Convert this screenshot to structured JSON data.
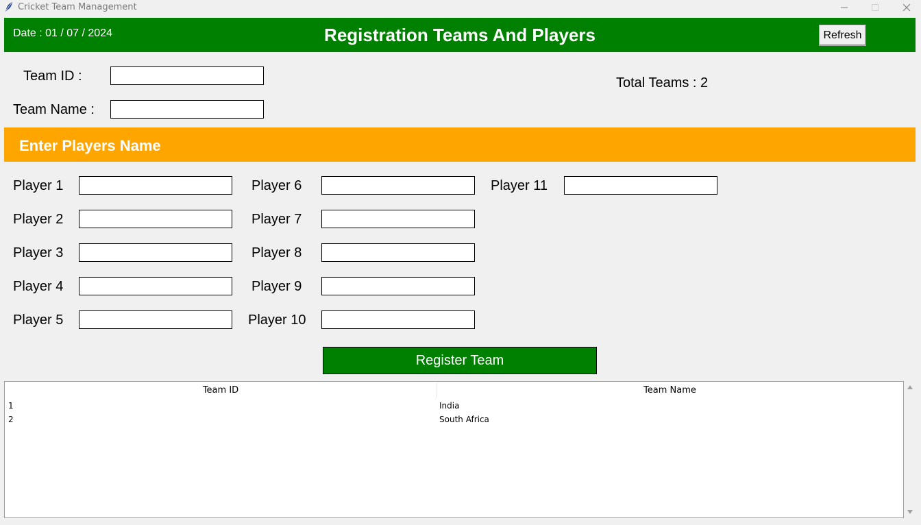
{
  "window": {
    "title": "Cricket Team Management",
    "icons": [
      "feather-icon",
      "minimize-icon",
      "maximize-icon",
      "close-icon"
    ]
  },
  "header": {
    "date": "Date : 01 / 07 / 2024",
    "title": "Registration Teams And Players",
    "refresh_label": "Refresh",
    "background": "#008000"
  },
  "team_form": {
    "team_id_label": "Team ID :",
    "team_id_value": "",
    "team_name_label": "Team Name :",
    "team_name_value": "",
    "total_teams": "Total Teams : 2"
  },
  "players_section": {
    "title": "Enter Players Name",
    "background": "#ffa500",
    "players": [
      {
        "label": "Player 1",
        "value": ""
      },
      {
        "label": "Player 2",
        "value": ""
      },
      {
        "label": "Player 3",
        "value": ""
      },
      {
        "label": "Player 4",
        "value": ""
      },
      {
        "label": "Player 5",
        "value": ""
      },
      {
        "label": "Player 6",
        "value": ""
      },
      {
        "label": "Player 7",
        "value": ""
      },
      {
        "label": "Player 8",
        "value": ""
      },
      {
        "label": "Player 9",
        "value": ""
      },
      {
        "label": "Player 10",
        "value": ""
      },
      {
        "label": "Player 11",
        "value": ""
      }
    ]
  },
  "register_button": {
    "label": "Register Team",
    "background": "#008000"
  },
  "teams_table": {
    "columns": [
      "Team ID",
      "Team Name"
    ],
    "rows": [
      {
        "id": "1",
        "name": "India"
      },
      {
        "id": "2",
        "name": "South Africa"
      }
    ]
  }
}
